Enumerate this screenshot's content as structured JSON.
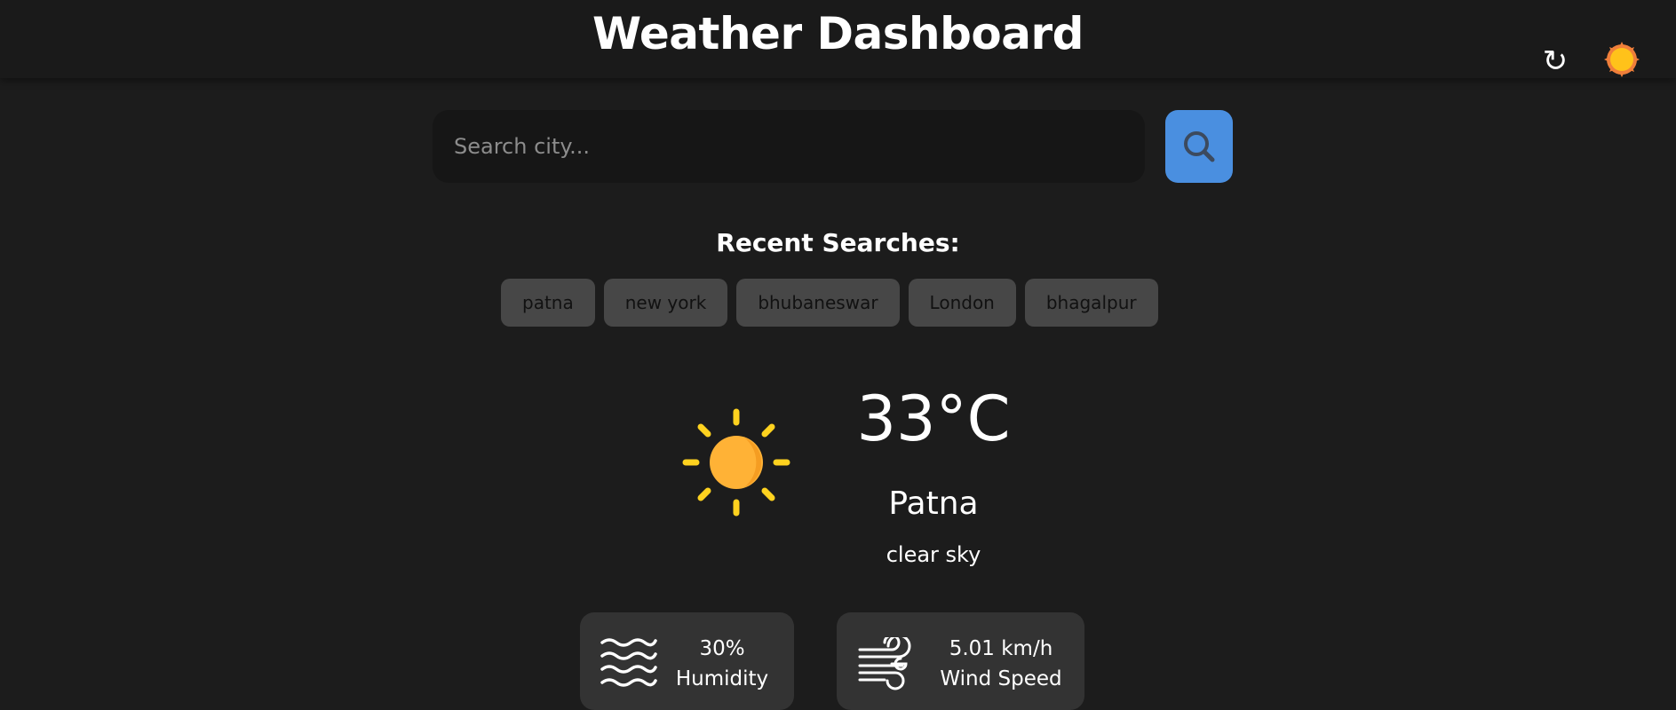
{
  "header": {
    "title": "Weather Dashboard",
    "refresh_icon": "refresh-icon",
    "theme_icon": "sun-icon"
  },
  "search": {
    "placeholder": "Search city...",
    "value": "",
    "button_icon": "search-icon"
  },
  "recent": {
    "title": "Recent Searches:",
    "items": [
      {
        "label": "patna"
      },
      {
        "label": "new york"
      },
      {
        "label": "bhubaneswar"
      },
      {
        "label": "London"
      },
      {
        "label": "bhagalpur"
      }
    ]
  },
  "current": {
    "icon": "clear-sky-sun-icon",
    "temperature": "33°C",
    "city": "Patna",
    "description": "clear sky"
  },
  "stats": {
    "humidity": {
      "value": "30%",
      "label": "Humidity",
      "icon": "humidity-waves-icon"
    },
    "wind": {
      "value": "5.01 km/h",
      "label": "Wind Speed",
      "icon": "wind-icon"
    }
  },
  "colors": {
    "background": "#1c1c1c",
    "header": "#1a1a1a",
    "accent": "#4a8fe0",
    "chip": "#474747",
    "card": "#333333",
    "sun": "#ffb236"
  }
}
